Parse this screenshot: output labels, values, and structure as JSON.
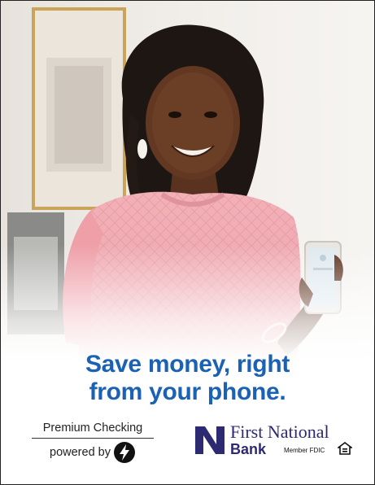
{
  "headline": {
    "line1": "Save money, right",
    "line2": "from your phone."
  },
  "premium": {
    "label": "Premium Checking",
    "powered": "powered by",
    "icon": "lightning-bolt-icon"
  },
  "bank": {
    "name": "First National",
    "sub": "Bank",
    "fdic": "Member FDIC",
    "mark_letter": "N",
    "icons": [
      "bank-logo-mark",
      "equal-housing-lender-icon"
    ]
  },
  "colors": {
    "headline": "#1b62b5",
    "bank_navy": "#2e2a72",
    "shirt_pink": "#efa9b1",
    "background": "#ffffff"
  }
}
